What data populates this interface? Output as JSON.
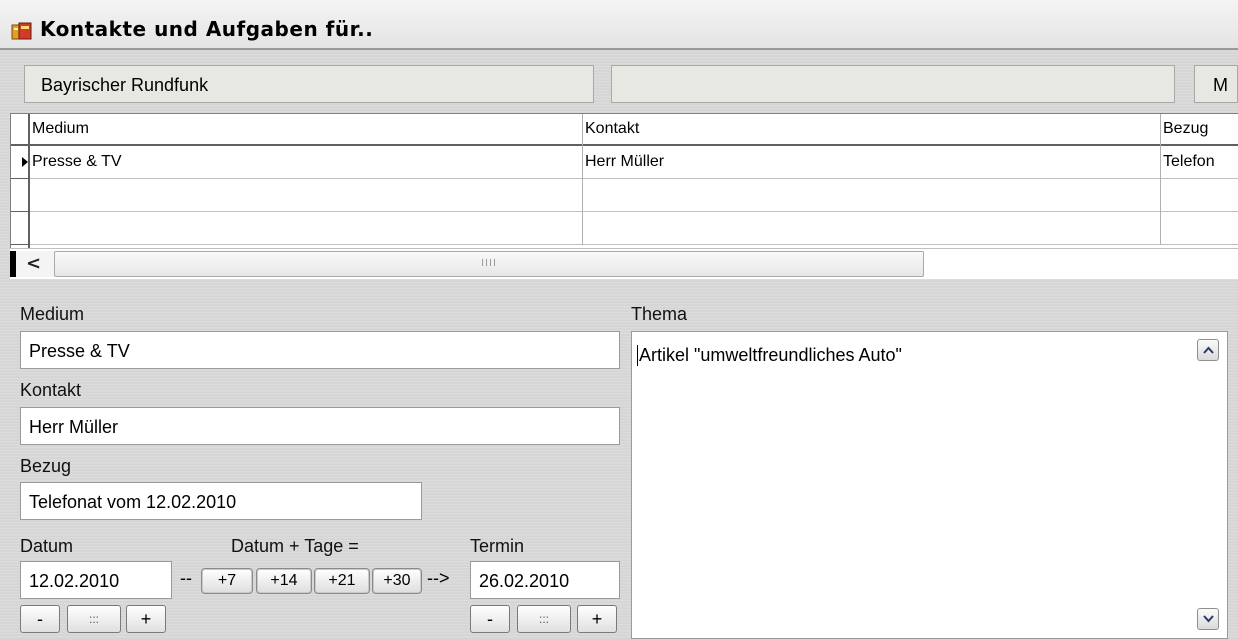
{
  "window": {
    "title": "Kontakte und Aufgaben für.."
  },
  "header_fields": {
    "organization": "Bayrischer Rundfunk",
    "middle": "",
    "right": "M"
  },
  "grid": {
    "columns": [
      "Medium",
      "Kontakt",
      "Bezug"
    ],
    "rows": [
      {
        "medium": "Presse & TV",
        "kontakt": "Herr Müller",
        "bezug": "Telefon"
      },
      {
        "medium": "",
        "kontakt": "",
        "bezug": ""
      },
      {
        "medium": "",
        "kontakt": "",
        "bezug": ""
      }
    ],
    "scroll_thumb_grip": "IIII"
  },
  "form": {
    "medium_label": "Medium",
    "medium_value": "Presse & TV",
    "kontakt_label": "Kontakt",
    "kontakt_value": "Herr Müller",
    "bezug_label": "Bezug",
    "bezug_value": "Telefonat vom 12.02.2010",
    "datum_label": "Datum",
    "datum_value": "12.02.2010",
    "datum_tage_label": "Datum + Tage =",
    "termin_label": "Termin",
    "termin_value": "26.02.2010",
    "sep_left": "--",
    "sep_right": "-->",
    "day_buttons": [
      "+7",
      "+14",
      "+21",
      "+30"
    ],
    "stepper": {
      "minus": "-",
      "mid": ":::",
      "plus": "+"
    },
    "thema_label": "Thema",
    "thema_value": "Artikel \"umweltfreundliches Auto\""
  },
  "icons": {
    "app": "app-window-icon",
    "row_pointer": "row-pointer-icon",
    "scroll_left": "scroll-left-icon",
    "scroll_up": "scroll-up-icon",
    "scroll_down": "scroll-down-icon"
  }
}
